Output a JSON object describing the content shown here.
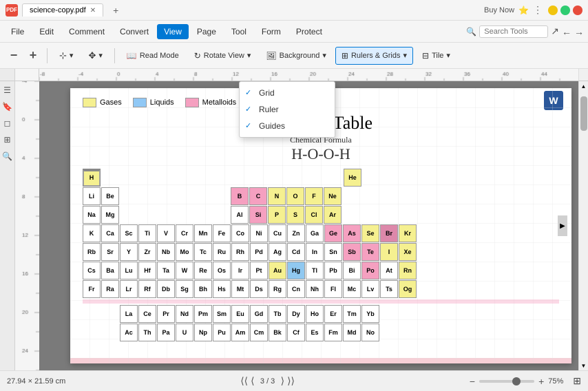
{
  "titleBar": {
    "appIcon": "PDF",
    "tabName": "science-copy.pdf",
    "newTabLabel": "+",
    "buyNow": "Buy Now"
  },
  "menuBar": {
    "items": [
      "File",
      "Edit",
      "Comment",
      "Convert",
      "View",
      "Page",
      "Tool",
      "Form",
      "Protect"
    ]
  },
  "toolbar": {
    "zoomOut": "−",
    "zoomIn": "+",
    "readMode": "Read Mode",
    "rotateView": "Rotate View",
    "background": "Background",
    "rulersGrids": "Rulers & Grids",
    "tile": "Tile",
    "searchPlaceholder": "Search Tools"
  },
  "dropdownMenu": {
    "items": [
      {
        "label": "Grid",
        "checked": true
      },
      {
        "label": "Ruler",
        "checked": true
      },
      {
        "label": "Guides",
        "checked": true
      }
    ]
  },
  "document": {
    "legend": [
      {
        "color": "#f5f090",
        "label": "Gases"
      },
      {
        "color": "#90c8f5",
        "label": "Liquids"
      },
      {
        "color": "#f5a0c0",
        "label": "Metalloids"
      }
    ],
    "title": "Periodic Table",
    "chemicalFormulaLabel": "Chemical Formula",
    "chemicalFormula": "H-O-O-H"
  },
  "statusBar": {
    "dimensions": "27.94 × 21.59 cm",
    "pageIndicator": "3 / 3",
    "zoomLevel": "75%"
  }
}
